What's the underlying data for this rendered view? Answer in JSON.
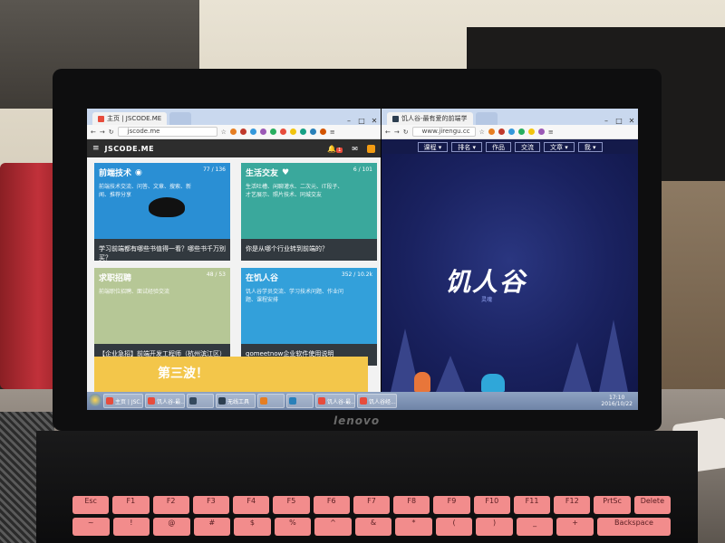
{
  "left_browser": {
    "tab_title": "主页 | JSCODE.ME",
    "url": "jscode.me",
    "site_logo": "JSCODE.ME",
    "notif_badge": "1",
    "cards": [
      {
        "title": "前端技术",
        "desc": "前端技术交流、问答、文章、搜索、新闻、推荐分享",
        "stats": "77 / 136",
        "bottom": "学习前端都有哪些书值得一看？哪些书千万别买？",
        "color": "#2a8fd4"
      },
      {
        "title": "生活交友",
        "desc": "生活吐槽、闲聊灌水、二次元、IT段子、才艺展示、照片技术、同城交友",
        "stats": "6 / 101",
        "bottom": "你是从哪个行业转到前端的？",
        "color": "#3aa89c"
      },
      {
        "title": "求职招聘",
        "desc": "前端职位招聘、面试经验交流",
        "stats": "48 / 53",
        "bottom": "【企业急招】前端开发工程师（杭州滨江区）",
        "color": "#8fb43a"
      },
      {
        "title": "在饥人谷",
        "desc": "饥人谷学员交流、学习技术问题、作业问题、课程安排",
        "stats": "352 / 10.2k",
        "bottom": "gomeetnow企业软件使用说明",
        "color": "#33a0da"
      }
    ],
    "promo_text": "第三波！"
  },
  "right_browser": {
    "tab_title": "饥人谷-最有爱的前端学",
    "url": "www.jirengu.cc",
    "nav": [
      "课程 ▾",
      "排名 ▾",
      "作品",
      "交流",
      "文章 ▾",
      "我 ▾"
    ],
    "hero_title": "饥人谷",
    "hero_sub": "灵魂"
  },
  "taskbar": {
    "items": [
      "主页 | JSC...",
      "饥人谷-最...",
      "",
      "无线工具",
      "",
      "",
      "饥人谷-最...",
      "饥人谷经..."
    ],
    "time": "17:10",
    "date": "2016/10/22"
  },
  "laptop": {
    "brand": "lenovo"
  },
  "keyboard": {
    "row1": [
      "Esc",
      "F1",
      "F2",
      "F3",
      "F4",
      "F5",
      "F6",
      "F7",
      "F8",
      "F9",
      "F10",
      "F11",
      "F12",
      "PrtSc",
      "Delete"
    ],
    "row2": [
      "~",
      "!",
      "@",
      "#",
      "$",
      "%",
      "^",
      "&",
      "*",
      "(",
      ")",
      "_",
      "+",
      "Backspace"
    ]
  }
}
